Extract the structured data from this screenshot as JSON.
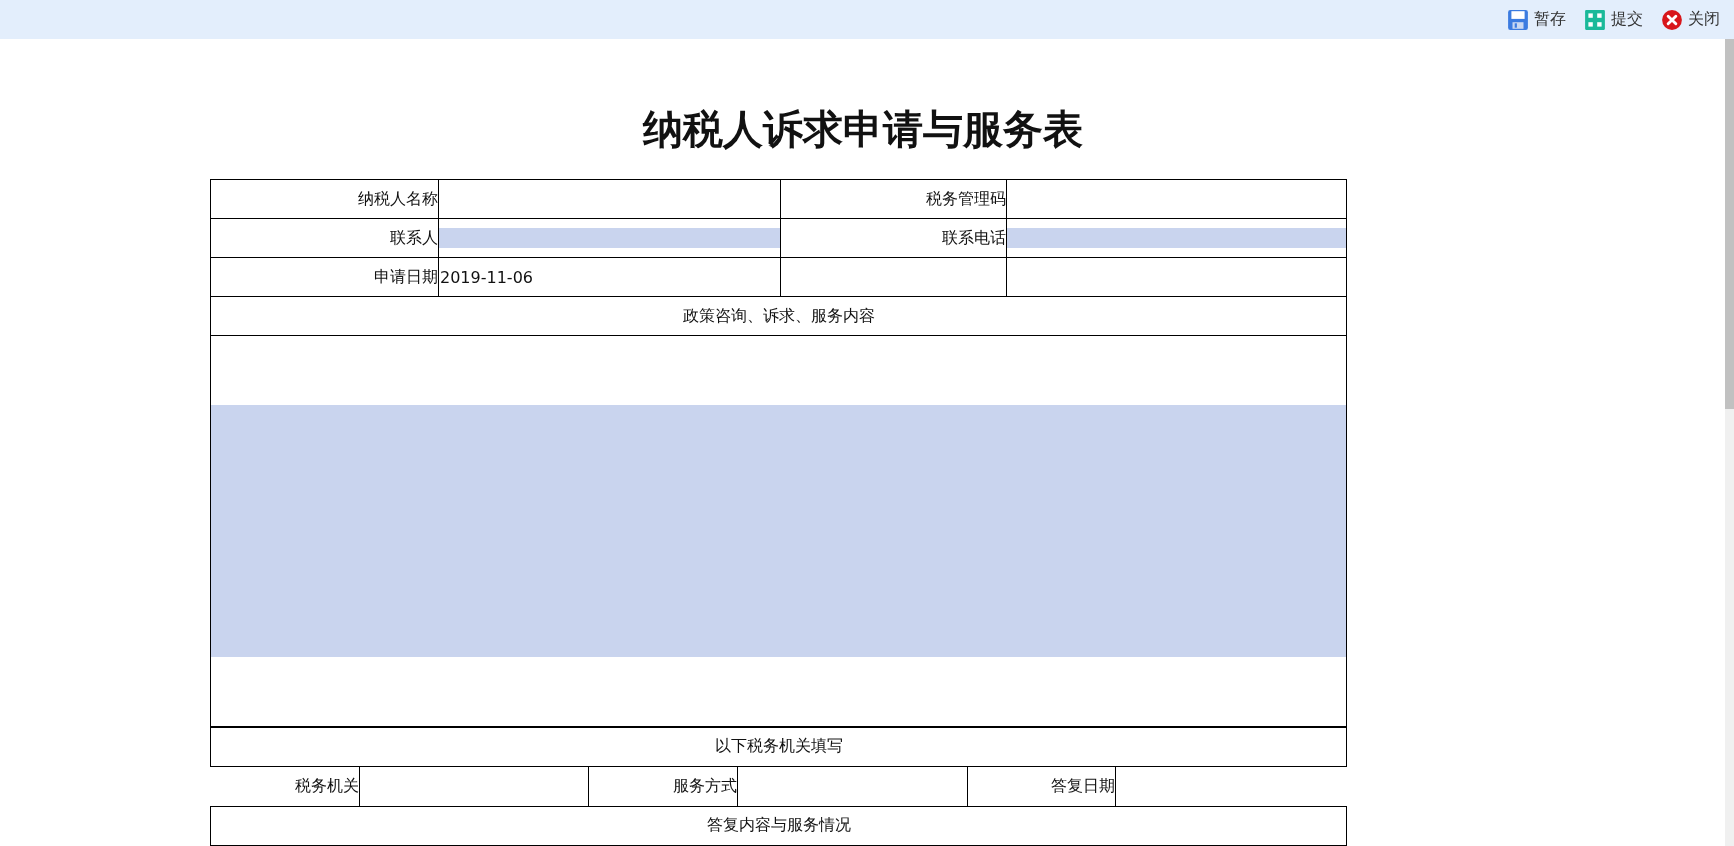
{
  "toolbar": [
    {
      "label": "暂存",
      "kind": "save"
    },
    {
      "label": "提交",
      "kind": "submit"
    },
    {
      "label": "关闭",
      "kind": "close"
    }
  ],
  "title": "纳税人诉求申请与服务表",
  "info_rows": [
    [
      {
        "label": "纳税人名称",
        "kind": "plain"
      },
      {
        "label": "税务管理码",
        "kind": "plain"
      }
    ],
    [
      {
        "label": "联系人",
        "kind": "highlighted"
      },
      {
        "label": "联系电话",
        "kind": "highlighted"
      }
    ],
    [
      {
        "label": "申请日期",
        "value": "2019-11-06",
        "kind": "plain"
      },
      {
        "kind": "plain"
      }
    ]
  ],
  "content_section": {
    "heading": "政策咨询、诉求、服务内容",
    "kind": "highlighted"
  },
  "office_section": {
    "heading": "以下税务机关填写",
    "fields": [
      {
        "label": "税务机关"
      },
      {
        "label": "服务方式"
      },
      {
        "label": "答复日期"
      }
    ]
  },
  "reply_section": {
    "heading": "答复内容与服务情况"
  }
}
